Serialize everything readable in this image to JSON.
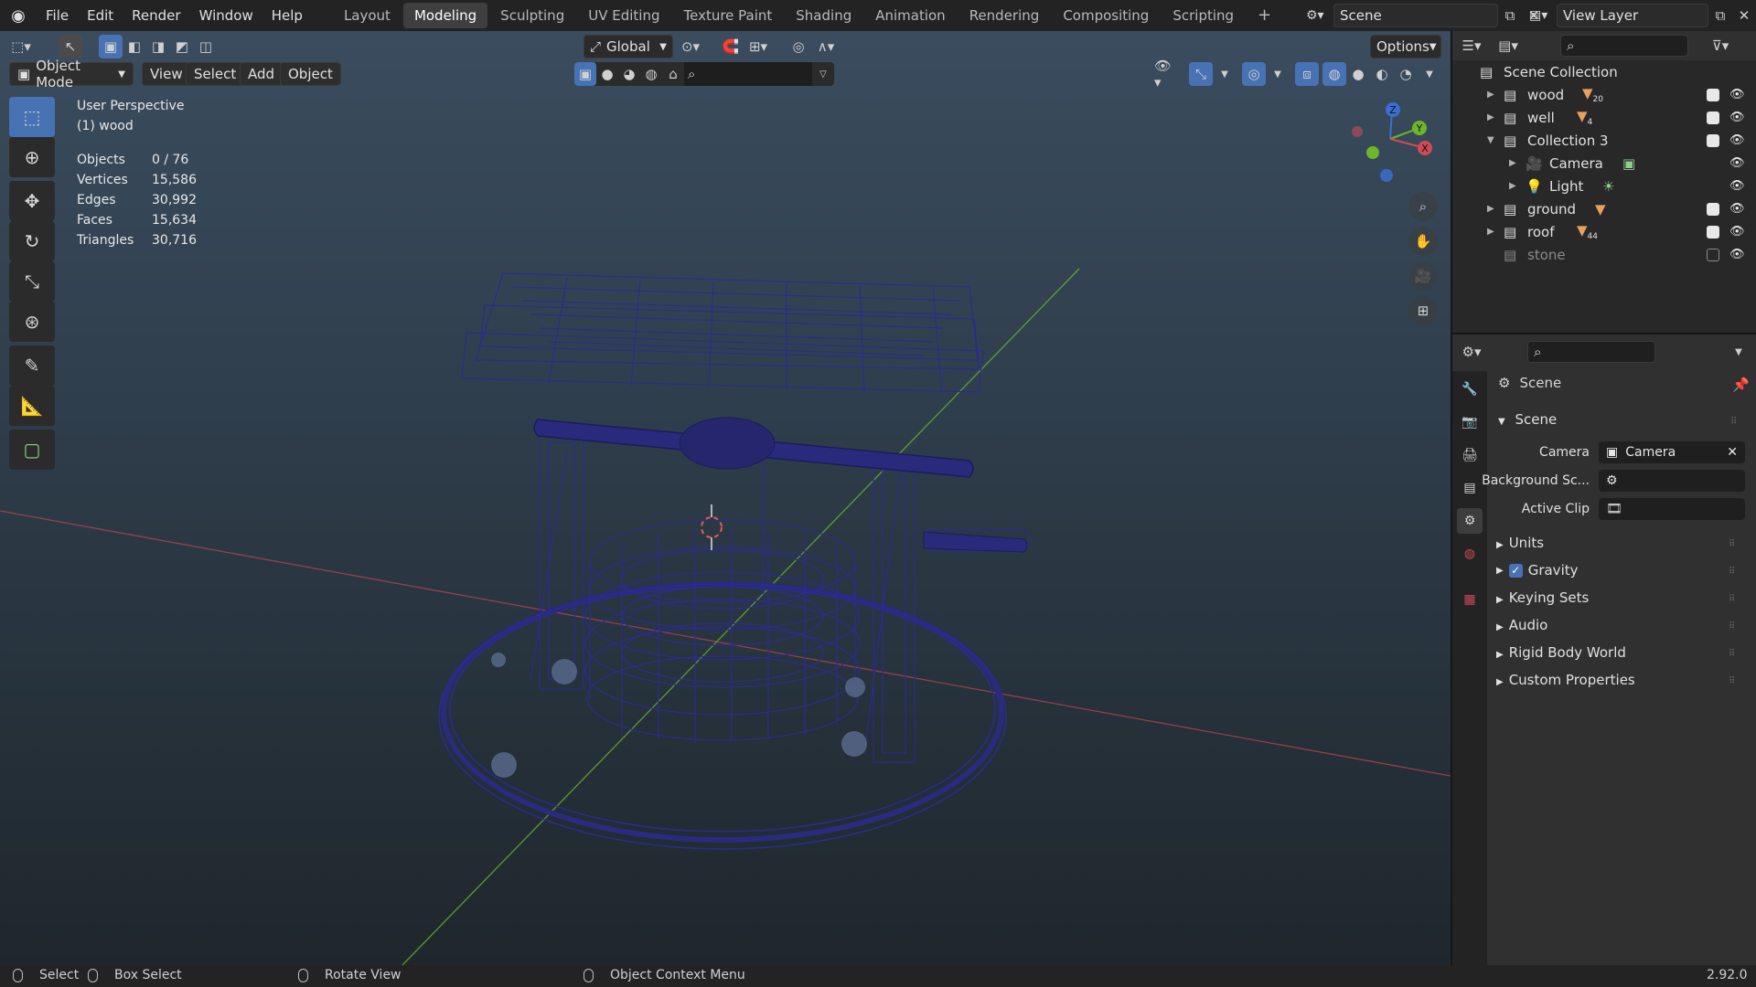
{
  "menu": {
    "file": "File",
    "edit": "Edit",
    "render": "Render",
    "window": "Window",
    "help": "Help"
  },
  "workspaces": [
    "Layout",
    "Modeling",
    "Sculpting",
    "UV Editing",
    "Texture Paint",
    "Shading",
    "Animation",
    "Rendering",
    "Compositing",
    "Scripting"
  ],
  "active_workspace": "Modeling",
  "scene_name": "Scene",
  "view_layer_name": "View Layer",
  "toolbar": {
    "transform_orientation": "Global",
    "options": "Options"
  },
  "viewport_header": {
    "mode": "Object Mode",
    "view": "View",
    "select": "Select",
    "add": "Add",
    "object": "Object"
  },
  "overlay_info": {
    "perspective": "User Perspective",
    "active": "(1) wood",
    "stats": [
      {
        "key": "Objects",
        "value": "0 / 76"
      },
      {
        "key": "Vertices",
        "value": "15,586"
      },
      {
        "key": "Edges",
        "value": "30,992"
      },
      {
        "key": "Faces",
        "value": "15,634"
      },
      {
        "key": "Triangles",
        "value": "30,716"
      }
    ]
  },
  "gizmo": {
    "z": "Z",
    "y": "Y",
    "x": "X"
  },
  "outliner": {
    "root": "Scene Collection",
    "items": [
      {
        "label": "wood",
        "badge": "20",
        "checked": true
      },
      {
        "label": "well",
        "badge": "4",
        "checked": true
      },
      {
        "label": "Collection 3",
        "badge": "",
        "checked": true
      },
      {
        "label": "Camera",
        "badge": "",
        "checked": null
      },
      {
        "label": "Light",
        "badge": "",
        "checked": null
      },
      {
        "label": "ground",
        "badge": "",
        "checked": true
      },
      {
        "label": "roof",
        "badge": "44",
        "checked": true
      },
      {
        "label": "stone",
        "badge": "",
        "checked": false
      }
    ]
  },
  "properties": {
    "context": "Scene",
    "section_scene": "Scene",
    "camera_label": "Camera",
    "camera_value": "Camera",
    "background_label": "Background Sc...",
    "active_clip_label": "Active Clip",
    "sections": [
      "Units",
      "Gravity",
      "Keying Sets",
      "Audio",
      "Rigid Body World",
      "Custom Properties"
    ]
  },
  "statusbar": {
    "select": "Select",
    "box_select": "Box Select",
    "rotate": "Rotate View",
    "context_menu": "Object Context Menu",
    "version": "2.92.0"
  },
  "colors": {
    "accent": "#4772b3",
    "wire": "#2a2a8a",
    "x_axis": "#c0484f",
    "y_axis": "#6fb52a"
  }
}
